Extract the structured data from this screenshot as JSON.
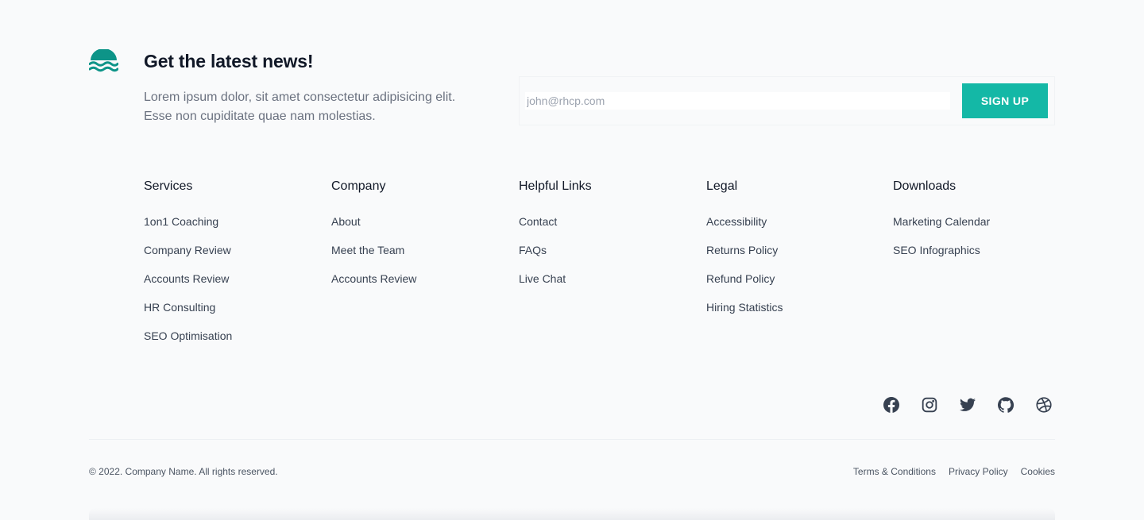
{
  "brand": {
    "logo_icon": "waves-logo-icon",
    "accent_color": "#14b8a6",
    "logo_color": "#0d9488"
  },
  "newsletter": {
    "title": "Get the latest news!",
    "description_line1": "Lorem ipsum dolor, sit amet consectetur adipisicing elit.",
    "description_line2": "Esse non cupiditate quae nam molestias.",
    "email_placeholder": "john@rhcp.com",
    "email_value": "",
    "signup_label": "SIGN UP"
  },
  "columns": [
    {
      "title": "Services",
      "links": [
        "1on1 Coaching",
        "Company Review",
        "Accounts Review",
        "HR Consulting",
        "SEO Optimisation"
      ]
    },
    {
      "title": "Company",
      "links": [
        "About",
        "Meet the Team",
        "Accounts Review"
      ]
    },
    {
      "title": "Helpful Links",
      "links": [
        "Contact",
        "FAQs",
        "Live Chat"
      ]
    },
    {
      "title": "Legal",
      "links": [
        "Accessibility",
        "Returns Policy",
        "Refund Policy",
        "Hiring Statistics"
      ]
    },
    {
      "title": "Downloads",
      "links": [
        "Marketing Calendar",
        "SEO Infographics"
      ]
    }
  ],
  "social": [
    {
      "icon": "facebook-icon"
    },
    {
      "icon": "instagram-icon"
    },
    {
      "icon": "twitter-icon"
    },
    {
      "icon": "github-icon"
    },
    {
      "icon": "dribbble-icon"
    }
  ],
  "bottom": {
    "copyright": "© 2022. Company Name. All rights reserved.",
    "links": [
      "Terms & Conditions",
      "Privacy Policy",
      "Cookies"
    ]
  }
}
